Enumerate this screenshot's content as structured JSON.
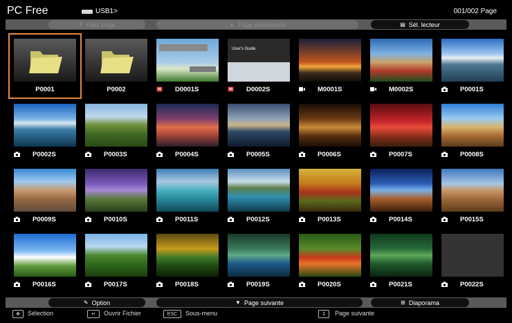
{
  "header": {
    "title": "PC Free",
    "drive": "USB1>",
    "page": "001/002 Page"
  },
  "topbar": {
    "top_label": "Haut page",
    "prev_label": "Page précédente",
    "drive_select_label": "Sél. lecteur"
  },
  "files": [
    {
      "label": "P0001",
      "type": "folder"
    },
    {
      "label": "P0002",
      "type": "folder"
    },
    {
      "label": "D0001S",
      "type": "document"
    },
    {
      "label": "D0002S",
      "type": "document",
      "preview_text": "User's Guide"
    },
    {
      "label": "M0001S",
      "type": "movie"
    },
    {
      "label": "M0002S",
      "type": "movie"
    },
    {
      "label": "P0001S",
      "type": "photo"
    },
    {
      "label": "P0002S",
      "type": "photo"
    },
    {
      "label": "P0003S",
      "type": "photo"
    },
    {
      "label": "P0004S",
      "type": "photo"
    },
    {
      "label": "P0005S",
      "type": "photo"
    },
    {
      "label": "P0006S",
      "type": "photo"
    },
    {
      "label": "P0007S",
      "type": "photo"
    },
    {
      "label": "P0008S",
      "type": "photo"
    },
    {
      "label": "P0009S",
      "type": "photo"
    },
    {
      "label": "P0010S",
      "type": "photo"
    },
    {
      "label": "P0011S",
      "type": "photo"
    },
    {
      "label": "P0012S",
      "type": "photo"
    },
    {
      "label": "P0013S",
      "type": "photo"
    },
    {
      "label": "P0014S",
      "type": "photo"
    },
    {
      "label": "P0015S",
      "type": "photo"
    },
    {
      "label": "P0016S",
      "type": "photo"
    },
    {
      "label": "P0017S",
      "type": "photo"
    },
    {
      "label": "P0018S",
      "type": "photo"
    },
    {
      "label": "P0019S",
      "type": "photo"
    },
    {
      "label": "P0020S",
      "type": "photo"
    },
    {
      "label": "P0021S",
      "type": "photo"
    },
    {
      "label": "P0022S",
      "type": "photo"
    }
  ],
  "selected_file": "P0001",
  "bottombar": {
    "option_label": "Option",
    "next_label": "Page suivante",
    "slideshow_label": "Diaporama"
  },
  "help": {
    "select_label": "Sélection",
    "open_label": "Ouvrir Fichier",
    "esc_key": "ESC",
    "submenu_label": "Sous-menu",
    "next_label": "Page suivante"
  },
  "colors": {
    "selection": "#e8893b",
    "bar": "#5a5a5a",
    "button_active": "#111111"
  }
}
